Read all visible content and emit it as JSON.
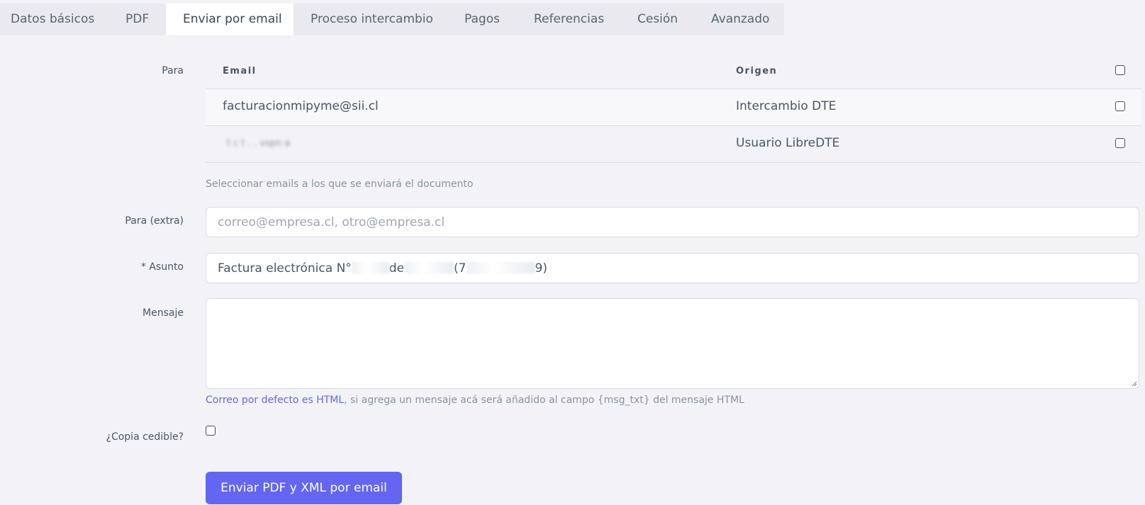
{
  "tabs": [
    {
      "label": "Datos básicos"
    },
    {
      "label": "PDF"
    },
    {
      "label": "Enviar por email"
    },
    {
      "label": "Proceso intercambio"
    },
    {
      "label": "Pagos"
    },
    {
      "label": "Referencias"
    },
    {
      "label": "Cesión"
    },
    {
      "label": "Avanzado"
    }
  ],
  "form": {
    "para_label": "Para",
    "para_extra_label": "Para (extra)",
    "asunto_label": "* Asunto",
    "mensaje_label": "Mensaje",
    "copia_label": "¿Copia cedible?"
  },
  "email_table": {
    "headers": {
      "email": "Email",
      "origen": "Origen"
    },
    "rows": [
      {
        "email": "facturacionmipyme@sii.cl",
        "origen": "Intercambio DTE"
      },
      {
        "email": "t c t . . vspn a",
        "origen": "Usuario LibreDTE"
      }
    ],
    "help": "Seleccionar emails a los que se enviará el documento"
  },
  "para_extra": {
    "value": "",
    "placeholder": "correo@empresa.cl, otro@empresa.cl"
  },
  "asunto": {
    "part1": "Factura electrónica N°",
    "part2": "de",
    "part3": "(7",
    "part4": "9)"
  },
  "mensaje": {
    "help_link": "Correo por defecto es HTML",
    "help_rest": ", si agrega un mensaje acá será añadido al campo {msg_txt} del mensaje HTML"
  },
  "submit": {
    "label": "Enviar PDF y XML por email"
  },
  "colors": {
    "accent": "#6466f1",
    "background": "#f3f3f7",
    "tab_bar": "#e9e9ef"
  }
}
